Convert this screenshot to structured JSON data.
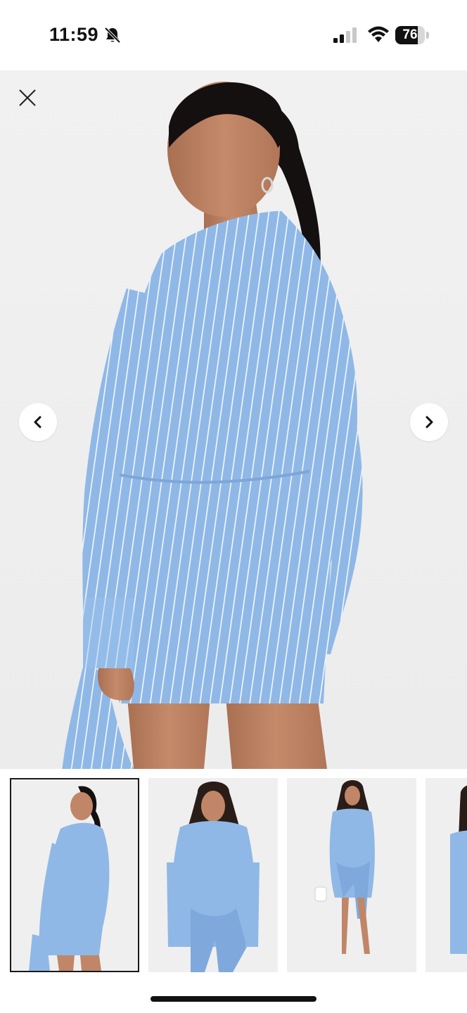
{
  "status_bar": {
    "time": "11:59",
    "battery_level": "76",
    "battery_fraction": 0.76,
    "icons": [
      "bell-slash-icon",
      "cellular-signal-icon",
      "wifi-icon",
      "battery-icon"
    ]
  },
  "gallery": {
    "close_icon": "close-icon",
    "prev_icon": "chevron-left-icon",
    "next_icon": "chevron-right-icon",
    "product_colors": {
      "dress_blue": "#8fb8e6",
      "stripe": "#f4f8ff",
      "background": "#efefef",
      "hair": "#141010",
      "skin": "#c48a6a"
    },
    "thumbnails": [
      {
        "name": "back-view",
        "selected": true
      },
      {
        "name": "front-view",
        "selected": false
      },
      {
        "name": "full-length-front-view",
        "selected": false
      },
      {
        "name": "side-view",
        "selected": false
      }
    ]
  }
}
